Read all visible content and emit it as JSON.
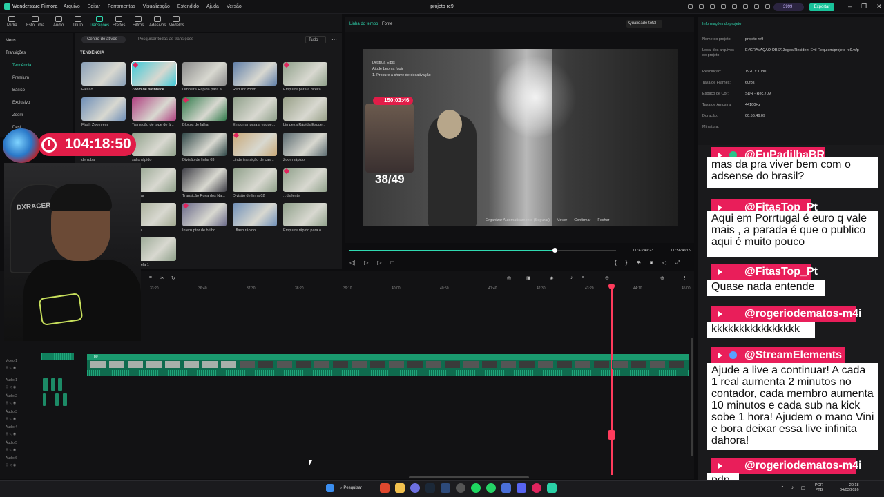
{
  "app": {
    "name": "Wonderstare Filmora",
    "project_title": "projeto re9",
    "export_label": "Exportar",
    "credits": "3999"
  },
  "menu": [
    "Arquivo",
    "Editar",
    "Ferramentas",
    "Visualização",
    "Estendido",
    "Ajuda",
    "Versão"
  ],
  "tool_tabs": [
    {
      "label": "Mídia",
      "icon": "media-icon"
    },
    {
      "label": "Esto...idia",
      "icon": "stock-media-icon"
    },
    {
      "label": "Áudio",
      "icon": "audio-icon"
    },
    {
      "label": "Título",
      "icon": "title-icon"
    },
    {
      "label": "Transições",
      "icon": "transitions-icon",
      "active": true
    },
    {
      "label": "Efeitos",
      "icon": "effects-icon"
    },
    {
      "label": "Filtros",
      "icon": "filters-icon"
    },
    {
      "label": "Adesivos",
      "icon": "stickers-icon"
    },
    {
      "label": "Modelos",
      "icon": "templates-icon"
    }
  ],
  "left_nav": {
    "sections": [
      "Meus",
      "Transições"
    ],
    "items": [
      {
        "label": "Tendência",
        "selected": true
      },
      {
        "label": "Premium"
      },
      {
        "label": "Básico"
      },
      {
        "label": "Exclusivo"
      },
      {
        "label": "Zoom"
      },
      {
        "label": "Desl..."
      }
    ]
  },
  "transitions": {
    "asset_center": "Centro de ativos",
    "search_placeholder": "Pesquisar todas as transições",
    "filter_label": "Tudo",
    "section_label": "TENDÊNCIA",
    "items": [
      {
        "label": "Flexão",
        "color": "#8aa0b8"
      },
      {
        "label": "Zoom de flashback",
        "color": "#3fc9d8",
        "selected": true
      },
      {
        "label": "Limpeza Rápida para a...",
        "color": "#8b8b8b"
      },
      {
        "label": "Reduzir zoom",
        "color": "#5f7ea8"
      },
      {
        "label": "Empurre para a direita",
        "color": "#8fa08a"
      },
      {
        "label": "Flash Zoom em",
        "color": "#6f8fb8"
      },
      {
        "label": "Transição de tope de á...",
        "color": "#b04080"
      },
      {
        "label": "Blocos de falha",
        "color": "#2f7a4a"
      },
      {
        "label": "Empurrar para a esque...",
        "color": "#8fa08a"
      },
      {
        "label": "Limpeza Rápida Esque...",
        "color": "#98a088"
      },
      {
        "label": "derrubar",
        "color": "#8fa08a"
      },
      {
        "label": "salto rápido",
        "color": "#8fa08a"
      },
      {
        "label": "Divisão de linha 03",
        "color": "#304848"
      },
      {
        "label": "Linde transição de cas...",
        "color": "#c8a878"
      },
      {
        "label": "Zoom rápido",
        "color": "#5a6a70"
      },
      {
        "label": "...o rápida",
        "color": "#8fa08a"
      },
      {
        "label": "Apagar",
        "color": "#8fa08a"
      },
      {
        "label": "Transição Roxa dos Na...",
        "color": "#404048"
      },
      {
        "label": "Divisão de linha 02",
        "color": "#8fa08a"
      },
      {
        "label": "...da lente",
        "color": "#8fa08a"
      },
      {
        "label": "Panela múltipla",
        "color": "#8fa08a"
      },
      {
        "label": "Vento",
        "color": "#a0a890"
      },
      {
        "label": "Interruptor de brilho",
        "color": "#6a6a8a"
      },
      {
        "label": "...flash rápido",
        "color": "#6f8fb8"
      },
      {
        "label": "Empurre rápido para o...",
        "color": "#8fa08a"
      },
      {
        "label": "Balançar para a esquer...",
        "color": "#c8a070"
      },
      {
        "label": "Cancela 1",
        "color": "#8fa08a"
      }
    ]
  },
  "preview": {
    "tab_timeline": "Linha do tempo",
    "tab_source": "Fonte",
    "quality": "Qualidade total",
    "current_time": "00:43:49:23",
    "total_time": "00:56:46:09",
    "progress": 0.77,
    "stream_timer": "150:03:46",
    "count": "38/49",
    "objective_title": "Destrua Elpis",
    "objective_1": "Ajude Leon a fugir",
    "objective_2": "1. Procure a chave de desativação",
    "game_hint": [
      "Organizar Automaticamente (Segurar)",
      "Mover",
      "Confirmar",
      "Fechar"
    ]
  },
  "project_info": {
    "header": "Informações do projeto",
    "rows": [
      {
        "k": "Nome do projeto:",
        "v": "projeto re9"
      },
      {
        "k": "Local dos arquivos do projeto:",
        "v": "E:/GRAVAÇÃO OBS/13ogos/Resident Evil Requiem/projeto re9.wfp"
      },
      {
        "k": "Resolução:",
        "v": "1920 x 1080"
      },
      {
        "k": "Taxa de Frames:",
        "v": "60fps"
      },
      {
        "k": "Espaço de Cor:",
        "v": "SDR - Rec.709"
      },
      {
        "k": "Taxa de Amostra:",
        "v": "44100Hz"
      },
      {
        "k": "Duração:",
        "v": "00:56:46:09"
      },
      {
        "k": "Miniatura:",
        "v": ""
      }
    ]
  },
  "timeline": {
    "ticks": [
      "33:20",
      "36:40",
      "37:30",
      "38:20",
      "39:10",
      "40:00",
      "40:50",
      "41:40",
      "42:30",
      "43:20",
      "44:10",
      "45:00"
    ],
    "tracks": [
      "Video 1",
      "Áudio 1",
      "Áudio 2",
      "Áudio 3",
      "Áudio 4",
      "Áudio 5",
      "Áudio 6"
    ],
    "clip_name": "p0"
  },
  "overlay": {
    "timer": "104:18:50",
    "chair_text": "DXRACER"
  },
  "chat": [
    {
      "user": "@EuPadilhaBR",
      "msg": "mas da pra viver bem com o adsense do brasil?"
    },
    {
      "user": "@FitasTop_Pt",
      "msg": "Aqui em Porrtugal é euro q vale mais , a parada é que o publico aqui é muito pouco"
    },
    {
      "user": "@FitasTop_Pt",
      "msg": "Quase nada entende"
    },
    {
      "user": "@rogeriodematos-m4i",
      "msg": "kkkkkkkkkkkkkkkk"
    },
    {
      "user": "@StreamElements",
      "msg": "Ajude a live a continuar! A cada 1 real aumenta 2 minutos no contador, cada membro aumenta 10 minutos e cada sub na kick sobe 1 hora! Ajudem o mano Vini e bora deixar essa live infinita dahora!"
    },
    {
      "user": "@rogeriodematos-m4i",
      "msg": "pdp"
    }
  ],
  "taskbar": {
    "search": "Pesquisar",
    "lang_1": "POR",
    "lang_2": "PTB",
    "time": "20:18",
    "date": "04/03/2026"
  }
}
